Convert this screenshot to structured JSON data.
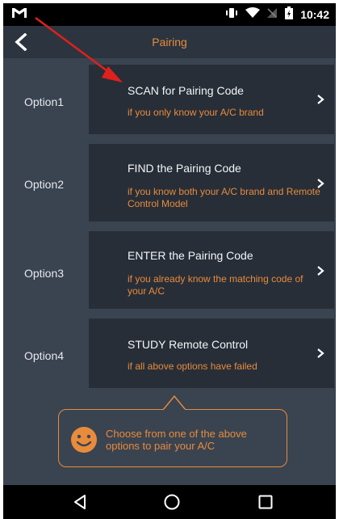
{
  "status_bar": {
    "time": "10:42"
  },
  "header": {
    "title": "Pairing"
  },
  "options": [
    {
      "label": "Option1",
      "title": "SCAN for Pairing Code",
      "subtitle": "if you only know your A/C brand"
    },
    {
      "label": "Option2",
      "title": "FIND the Pairing Code",
      "subtitle": "if you know both your A/C brand and Remote Control Model"
    },
    {
      "label": "Option3",
      "title": "ENTER the Pairing Code",
      "subtitle": "if you already know the matching code of your A/C"
    },
    {
      "label": "Option4",
      "title": "STUDY Remote Control",
      "subtitle": "if all above options have failed"
    }
  ],
  "tooltip": {
    "text": "Choose from one of the above options to pair your A/C"
  },
  "colors": {
    "accent": "#e88b3c",
    "background": "#3a4350",
    "card": "#272e38",
    "header": "#2c3440",
    "annotation": "#e0201c"
  },
  "icons": {
    "status": [
      "gmail-icon",
      "vibrate-icon",
      "wifi-icon",
      "no-signal-icon",
      "battery-icon"
    ],
    "nav": [
      "back-triangle-icon",
      "home-circle-icon",
      "recents-square-icon"
    ]
  }
}
